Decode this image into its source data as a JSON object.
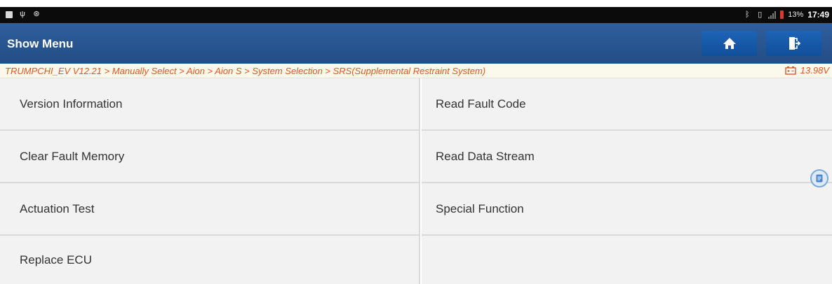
{
  "status_bar": {
    "battery_percent": "13%",
    "time": "17:49"
  },
  "header": {
    "title": "Show Menu",
    "home_icon": "home-icon",
    "exit_icon": "exit-icon"
  },
  "breadcrumb": {
    "path": "TRUMPCHI_EV V12.21 > Manually Select > Aion > Aion S > System Selection > SRS(Supplemental Restraint System)",
    "voltage": "13.98V",
    "accent_color": "#e2561f"
  },
  "menu": {
    "items": [
      {
        "label": "Version Information"
      },
      {
        "label": "Read Fault Code"
      },
      {
        "label": "Clear Fault Memory"
      },
      {
        "label": "Read Data Stream"
      },
      {
        "label": "Actuation Test"
      },
      {
        "label": "Special Function"
      },
      {
        "label": "Replace ECU"
      },
      {
        "label": ""
      }
    ]
  },
  "colors": {
    "title_bar": "#2a5792",
    "status_bar": "#0b0b0b",
    "cell_bg": "#f2f2f2"
  }
}
